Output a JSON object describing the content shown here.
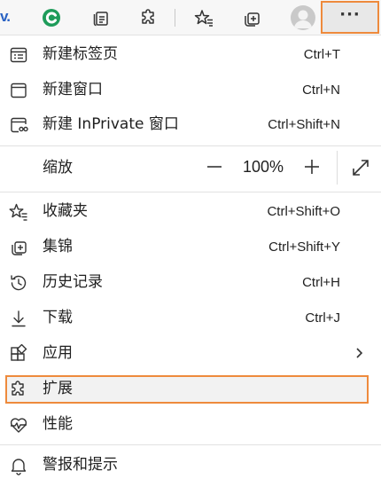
{
  "toolbar": {
    "partial_text": "v.",
    "items": [
      "refresh-c-icon",
      "collections-stack-icon",
      "extensions-puzzle-icon",
      "favorites-star-icon",
      "collections-add-icon",
      "profile-avatar",
      "more-dots-icon"
    ],
    "more_label": "···"
  },
  "menu": {
    "new_tab": {
      "label": "新建标签页",
      "shortcut": "Ctrl+T"
    },
    "new_window": {
      "label": "新建窗口",
      "shortcut": "Ctrl+N"
    },
    "new_inprivate": {
      "label": "新建 InPrivate 窗口",
      "shortcut": "Ctrl+Shift+N"
    },
    "zoom": {
      "label": "缩放",
      "minus": "—",
      "value": "100%",
      "plus": "+"
    },
    "favorites": {
      "label": "收藏夹",
      "shortcut": "Ctrl+Shift+O"
    },
    "collections": {
      "label": "集锦",
      "shortcut": "Ctrl+Shift+Y"
    },
    "history": {
      "label": "历史记录",
      "shortcut": "Ctrl+H"
    },
    "downloads": {
      "label": "下载",
      "shortcut": "Ctrl+J"
    },
    "apps": {
      "label": "应用"
    },
    "extensions": {
      "label": "扩展"
    },
    "performance": {
      "label": "性能"
    },
    "alerts": {
      "label": "警报和提示"
    }
  },
  "colors": {
    "highlight_border": "#ee8a3c",
    "brand_green": "#1e9c5a",
    "partial_text_blue": "#2b63c4"
  }
}
